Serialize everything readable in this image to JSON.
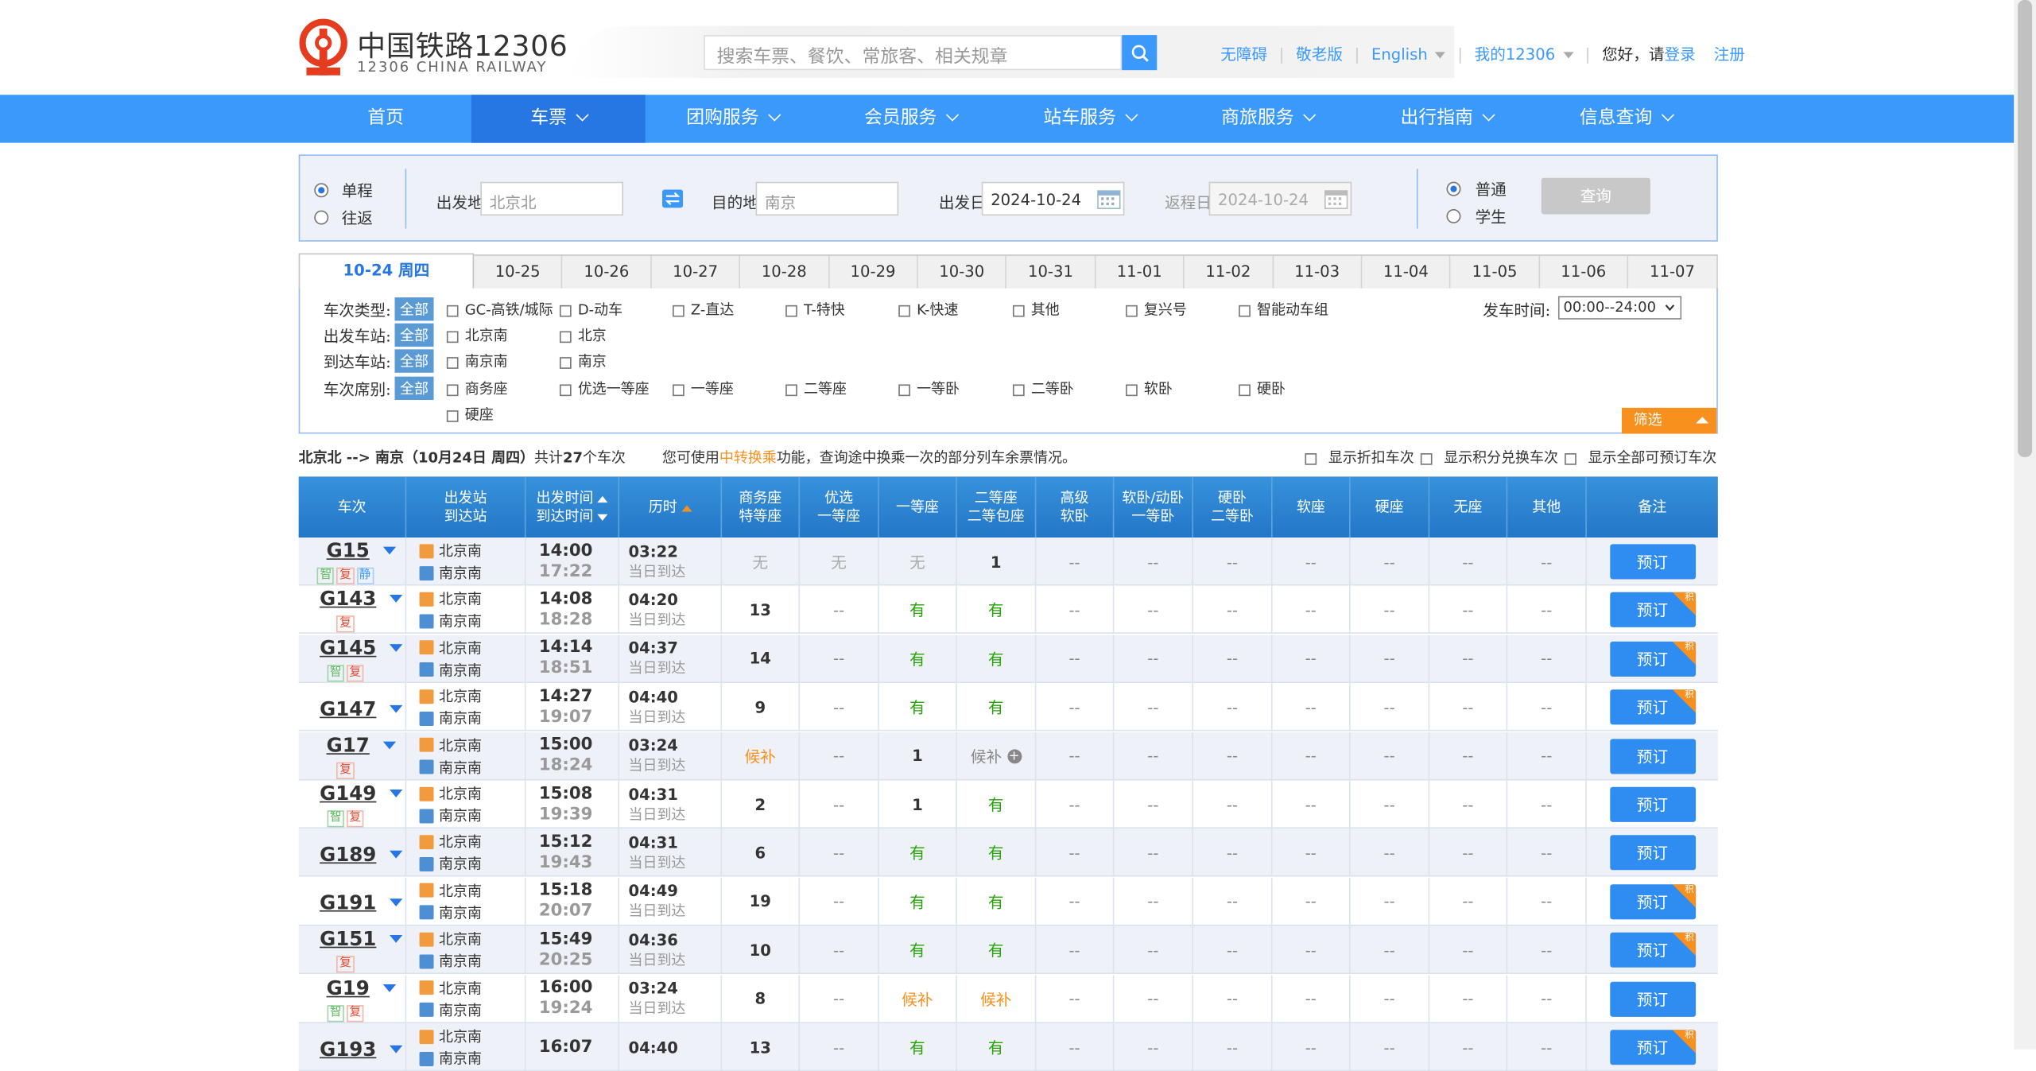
{
  "brand": {
    "name_cn": "中国铁路12306",
    "name_en": "12306 CHINA RAILWAY"
  },
  "search": {
    "placeholder": "搜索车票、餐饮、常旅客、相关规章"
  },
  "toplinks": {
    "accessible": "无障碍",
    "elder": "敬老版",
    "english": "English",
    "my12306": "我的12306",
    "greeting": "您好，请",
    "login": "登录",
    "register": "注册"
  },
  "nav": [
    "首页",
    "车票",
    "团购服务",
    "会员服务",
    "站车服务",
    "商旅服务",
    "出行指南",
    "信息查询"
  ],
  "query": {
    "oneway": "单程",
    "roundtrip": "往返",
    "from_label": "出发地",
    "from_value": "北京北",
    "to_label": "目的地",
    "to_value": "南京",
    "depart_label": "出发日",
    "depart_value": "2024-10-24",
    "return_label": "返程日",
    "return_value": "2024-10-24",
    "normal": "普通",
    "student": "学生",
    "button": "查询"
  },
  "dates": [
    "10-24 周四",
    "10-25",
    "10-26",
    "10-27",
    "10-28",
    "10-29",
    "10-30",
    "10-31",
    "11-01",
    "11-02",
    "11-03",
    "11-04",
    "11-05",
    "11-06",
    "11-07"
  ],
  "filters": {
    "type_label": "车次类型:",
    "from_label": "出发车站:",
    "to_label": "到达车站:",
    "seat_label": "车次席别:",
    "all": "全部",
    "types": [
      "GC-高铁/城际",
      "D-动车",
      "Z-直达",
      "T-特快",
      "K-快速",
      "其他",
      "复兴号",
      "智能动车组"
    ],
    "from_stations": [
      "北京南",
      "北京"
    ],
    "to_stations": [
      "南京南",
      "南京"
    ],
    "seats": [
      "商务座",
      "优选一等座",
      "一等座",
      "二等座",
      "一等卧",
      "二等卧",
      "软卧",
      "硬卧",
      "硬座"
    ],
    "time_label": "发车时间:",
    "time_value": "00:00--24:00",
    "filter_btn": "筛选"
  },
  "summary": {
    "route": "北京北 --> 南京",
    "date": "（10月24日  周四）",
    "total_prefix": "共计",
    "count": "27",
    "total_suffix": "个车次"
  },
  "hint": {
    "prefix": "您可使用",
    "highlight": "中转换乘",
    "suffix": "功能，查询途中换乘一次的部分列车余票情况。"
  },
  "show_options": [
    "显示折扣车次",
    "显示积分兑换车次",
    "显示全部可预订车次"
  ],
  "headers": {
    "train": "车次",
    "station1": "出发站",
    "station2": "到达站",
    "time1": "出发时间",
    "time2": "到达时间",
    "duration": "历时",
    "biz1": "商务座",
    "biz2": "特等座",
    "pref1": "优选",
    "pref2": "一等座",
    "first": "一等座",
    "second1": "二等座",
    "second2": "二等包座",
    "adv1": "高级",
    "adv2": "软卧",
    "soft1": "软卧/动卧",
    "soft2": "一等卧",
    "hard1": "硬卧",
    "hard2": "二等卧",
    "softseat": "软座",
    "hardseat": "硬座",
    "noseat": "无座",
    "other": "其他",
    "remark": "备注"
  },
  "book_label": "预订",
  "corner_label": "积",
  "trains": [
    {
      "no": "G15",
      "tags": [
        "智",
        "复",
        "静"
      ],
      "from": "北京南",
      "to": "南京南",
      "dep": "14:00",
      "arr": "17:22",
      "dur": "03:22",
      "note": "当日到达",
      "biz": "无",
      "pref": "无",
      "first": "无",
      "second": "1",
      "corner": false
    },
    {
      "no": "G143",
      "tags": [
        "复"
      ],
      "from": "北京南",
      "to": "南京南",
      "dep": "14:08",
      "arr": "18:28",
      "dur": "04:20",
      "note": "当日到达",
      "biz": "13",
      "pref": "--",
      "first": "有",
      "second": "有",
      "corner": true
    },
    {
      "no": "G145",
      "tags": [
        "智",
        "复"
      ],
      "from": "北京南",
      "to": "南京南",
      "dep": "14:14",
      "arr": "18:51",
      "dur": "04:37",
      "note": "当日到达",
      "biz": "14",
      "pref": "--",
      "first": "有",
      "second": "有",
      "corner": true
    },
    {
      "no": "G147",
      "tags": [],
      "from": "北京南",
      "to": "南京南",
      "dep": "14:27",
      "arr": "19:07",
      "dur": "04:40",
      "note": "当日到达",
      "biz": "9",
      "pref": "--",
      "first": "有",
      "second": "有",
      "corner": true
    },
    {
      "no": "G17",
      "tags": [
        "复"
      ],
      "from": "北京南",
      "to": "南京南",
      "dep": "15:00",
      "arr": "18:24",
      "dur": "03:24",
      "note": "当日到达",
      "biz": "候补",
      "pref": "--",
      "first": "1",
      "second": "候补",
      "corner": false
    },
    {
      "no": "G149",
      "tags": [
        "智",
        "复"
      ],
      "from": "北京南",
      "to": "南京南",
      "dep": "15:08",
      "arr": "19:39",
      "dur": "04:31",
      "note": "当日到达",
      "biz": "2",
      "pref": "--",
      "first": "1",
      "second": "有",
      "corner": false
    },
    {
      "no": "G189",
      "tags": [],
      "from": "北京南",
      "to": "南京南",
      "dep": "15:12",
      "arr": "19:43",
      "dur": "04:31",
      "note": "当日到达",
      "biz": "6",
      "pref": "--",
      "first": "有",
      "second": "有",
      "corner": false
    },
    {
      "no": "G191",
      "tags": [],
      "from": "北京南",
      "to": "南京南",
      "dep": "15:18",
      "arr": "20:07",
      "dur": "04:49",
      "note": "当日到达",
      "biz": "19",
      "pref": "--",
      "first": "有",
      "second": "有",
      "corner": true
    },
    {
      "no": "G151",
      "tags": [
        "复"
      ],
      "from": "北京南",
      "to": "南京南",
      "dep": "15:49",
      "arr": "20:25",
      "dur": "04:36",
      "note": "当日到达",
      "biz": "10",
      "pref": "--",
      "first": "有",
      "second": "有",
      "corner": true
    },
    {
      "no": "G19",
      "tags": [
        "智",
        "复"
      ],
      "from": "北京南",
      "to": "南京南",
      "dep": "16:00",
      "arr": "19:24",
      "dur": "03:24",
      "note": "当日到达",
      "biz": "8",
      "pref": "--",
      "first": "候补",
      "second": "候补",
      "corner": false
    },
    {
      "no": "G193",
      "tags": [],
      "from": "北京南",
      "to": "南京南",
      "dep": "16:07",
      "arr": "",
      "dur": "04:40",
      "note": "",
      "biz": "13",
      "pref": "--",
      "first": "有",
      "second": "有",
      "corner": true
    }
  ],
  "dash": "--",
  "colors": {
    "nav": "#3b99fc",
    "nav_active": "#2676e3",
    "header": "#2276c6",
    "orange": "#f8901e",
    "green": "#26a306"
  }
}
